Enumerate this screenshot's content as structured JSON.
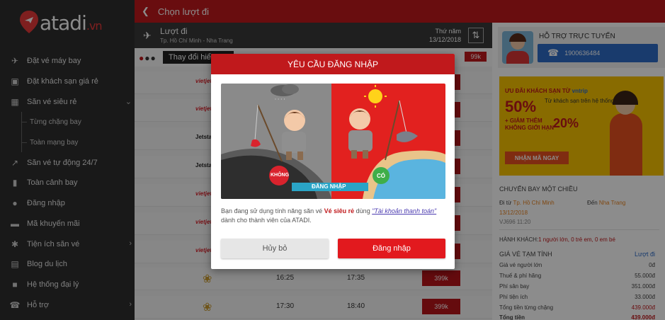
{
  "brand": {
    "logo_text": "atadi",
    "logo_suffix": ".vn"
  },
  "sidebar": {
    "items": [
      {
        "label": "Đặt vé máy bay",
        "icon": "plane-icon"
      },
      {
        "label": "Đặt khách sạn giá rẻ",
        "icon": "hotel-icon"
      },
      {
        "label": "Săn vé siêu rẻ",
        "icon": "calendar-icon"
      },
      {
        "label": "Từng chặng bay",
        "sub": true
      },
      {
        "label": "Toàn mạng bay",
        "sub": true
      },
      {
        "label": "Săn vé tự động 24/7",
        "icon": "trend-icon"
      },
      {
        "label": "Toàn cảnh bay",
        "icon": "bar-chart-icon"
      },
      {
        "label": "Đăng nhập",
        "icon": "user-icon"
      },
      {
        "label": "Mã khuyến mãi",
        "icon": "card-icon"
      },
      {
        "label": "Tiện ích săn vé",
        "icon": "magic-icon"
      },
      {
        "label": "Blog du lịch",
        "icon": "book-icon"
      },
      {
        "label": "Hệ thống đại lý",
        "icon": "briefcase-icon"
      },
      {
        "label": "Hỗ trợ",
        "icon": "phone-icon"
      }
    ]
  },
  "header": {
    "title": "Chọn lượt đi"
  },
  "route": {
    "title": "Lượt đi",
    "subtitle": "Tp. Hồ Chí Minh - Nha Trang",
    "weekday": "Thứ năm",
    "date": "13/12/2018"
  },
  "filter": {
    "tooltip": "Thay đổi hiển",
    "tag_price": "99k"
  },
  "flights": [
    {
      "airline": "vietjet",
      "dep": "",
      "arr": "",
      "price": ""
    },
    {
      "airline": "vietjet",
      "dep": "",
      "arr": "",
      "price": ""
    },
    {
      "airline": "Jetstar",
      "dep": "",
      "arr": "",
      "price": ""
    },
    {
      "airline": "Jetstar",
      "dep": "",
      "arr": "",
      "price": ""
    },
    {
      "airline": "vietjet",
      "dep": "",
      "arr": "",
      "price": ""
    },
    {
      "airline": "vietjet",
      "dep": "",
      "arr": "",
      "price": ""
    },
    {
      "airline": "vietjet",
      "dep": "",
      "arr": "",
      "price": ""
    },
    {
      "airline": "vna",
      "dep": "16:25",
      "arr": "17:35",
      "price": "399k"
    },
    {
      "airline": "vna",
      "dep": "17:30",
      "arr": "18:40",
      "price": "399k"
    }
  ],
  "support": {
    "title": "HỖ TRỢ TRỰC TUYẾN",
    "hotline": "1900636484"
  },
  "promo": {
    "line1": "ƯU ĐÃI KHÁCH SẠN TỪ",
    "brand": "vntrip",
    "pct1": "50%",
    "line2": "Từ khách sạn trên hệ thống",
    "line3": "+ GIẢM THÊM",
    "line4": "KHÔNG GIỚI HẠN",
    "pct2": "20%",
    "cta": "NHẬN MÃ NGAY"
  },
  "trip": {
    "title": "CHUYẾN BAY MỘT CHIỀU",
    "from_label": "Đi từ",
    "from": "Tp. Hồ Chí Minh",
    "to_label": "Đến",
    "to": "Nha Trang",
    "date": "13/12/2018",
    "flight_time": "VJ696  11:20",
    "passengers_label": "HÀNH KHÁCH:",
    "passengers": "1 người lớn, 0 trẻ em, 0 em bé"
  },
  "fare": {
    "title": "GIÁ VÉ TẠM TÍNH",
    "title_right": "Lượt đi",
    "rows": [
      {
        "label": "Giá vé người lớn",
        "value": "0đ"
      },
      {
        "label": "Thuế & phí hãng",
        "value": "55.000đ"
      },
      {
        "label": "Phí sân bay",
        "value": "351.000đ"
      },
      {
        "label": "Phí tiện ích",
        "value": "33.000đ"
      },
      {
        "label": "Tổng tiền từng chặng",
        "value": "439.000đ"
      },
      {
        "label": "Tổng tiền",
        "value": "439.000đ"
      }
    ]
  },
  "modal": {
    "title": "YÊU CẦU ĐĂNG NHẬP",
    "badge_no": "KHÔNG",
    "badge_yes": "CÓ",
    "banner": "ĐĂNG NHẬP",
    "text_1": "Bạn đang sử dụng tính năng săn vé ",
    "text_highlight": "Vé siêu rẻ",
    "text_2": " dùng ",
    "text_link": "\"Tài khoản thanh toán\"",
    "text_3": " dành cho thành viên của ATADI.",
    "cancel_label": "Hủy bỏ",
    "login_label": "Đăng nhập"
  },
  "colors": {
    "brand_red": "#c0191c",
    "sidebar_bg": "#2e2e2e",
    "hotline_blue": "#2f6cc7",
    "promo_yellow": "#f7c300"
  }
}
